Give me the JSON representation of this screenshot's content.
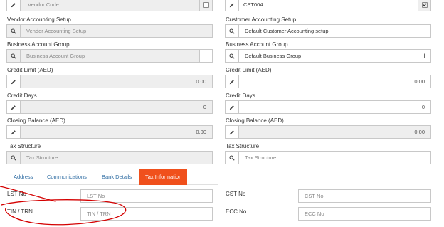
{
  "left": {
    "vendor_code": {
      "placeholder": "Vendor Code"
    },
    "vendor_accounting_setup": {
      "label": "Vendor Accounting Setup",
      "placeholder": "Vendor Accounting Setup"
    },
    "business_account_group": {
      "label": "Business Account Group",
      "placeholder": "Business Account Group"
    },
    "credit_limit": {
      "label": "Credit Limit (AED)",
      "value": "0.00"
    },
    "credit_days": {
      "label": "Credit Days",
      "value": "0"
    },
    "closing_balance": {
      "label": "Closing Balance (AED)",
      "value": "0.00"
    },
    "tax_structure": {
      "label": "Tax Structure",
      "placeholder": "Tax Structure"
    }
  },
  "right": {
    "customer_code": {
      "value": "CST004",
      "checked": true
    },
    "customer_accounting_setup": {
      "label": "Customer Accounting Setup",
      "value": "Default Customer Accounting setup"
    },
    "business_account_group": {
      "label": "Business Account Group",
      "value": "Default Business Group"
    },
    "credit_limit": {
      "label": "Credit Limit (AED)",
      "value": "0.00"
    },
    "credit_days": {
      "label": "Credit Days",
      "value": "0"
    },
    "closing_balance": {
      "label": "Closing Balance (AED)",
      "value": "0.00"
    },
    "tax_structure": {
      "label": "Tax Structure",
      "placeholder": "Tax Structure"
    }
  },
  "tabs": [
    {
      "label": "Address",
      "active": false
    },
    {
      "label": "Communications",
      "active": false
    },
    {
      "label": "Bank Details",
      "active": false
    },
    {
      "label": "Tax Information",
      "active": true
    }
  ],
  "tax_info": {
    "lst_no": {
      "label": "LST No",
      "placeholder": "LST No"
    },
    "tin_trn": {
      "label": "TIN / TRN",
      "placeholder": "TIN / TRN"
    },
    "cst_no": {
      "label": "CST No",
      "placeholder": "CST No"
    },
    "ecc_no": {
      "label": "ECC No",
      "placeholder": "ECC No"
    }
  },
  "icons": {
    "pencil": "pencil-icon",
    "search": "search-icon",
    "plus": "plus-icon",
    "checkbox": "checkbox-icon"
  },
  "colors": {
    "active_tab": "#f0501c",
    "tab_link": "#2f6da3",
    "disabled_field": "#eeeeee",
    "annotation": "#d40000"
  }
}
